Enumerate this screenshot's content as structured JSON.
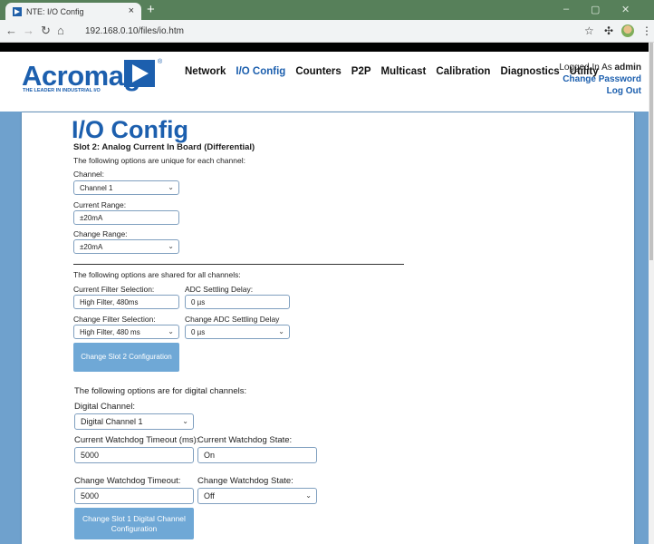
{
  "browser": {
    "tab_title": "NTE: I/O Config",
    "tab_close": "×",
    "new_tab": "+",
    "url": "192.168.0.10/files/io.htm",
    "minimize": "–",
    "maximize": "▢",
    "close": "✕"
  },
  "header": {
    "logo_text": "Acromag",
    "logo_tagline": "THE LEADER IN INDUSTRIAL I/O",
    "logo_registered": "®",
    "nav": [
      {
        "label": "Network"
      },
      {
        "label": "I/O Config"
      },
      {
        "label": "Counters"
      },
      {
        "label": "P2P"
      },
      {
        "label": "Multicast"
      },
      {
        "label": "Calibration"
      },
      {
        "label": "Diagnostics"
      },
      {
        "label": "Utility"
      }
    ],
    "logged_in_prefix": "Logged In As",
    "user": "admin",
    "change_password": "Change Password",
    "logout": "Log Out"
  },
  "page": {
    "title": "I/O Config",
    "slot_heading": "Slot 2: Analog Current In Board (Differential)",
    "unique_note": "The following options are unique for each channel:",
    "channel_label": "Channel:",
    "channel_value": "Channel 1",
    "current_range_label": "Current Range:",
    "current_range_value": "±20mA",
    "change_range_label": "Change Range:",
    "change_range_value": "±20mA",
    "shared_note": "The following options are shared for all channels:",
    "current_filter_label": "Current Filter Selection:",
    "current_filter_value": "High Filter, 480ms",
    "adc_delay_label": "ADC Settling Delay:",
    "adc_delay_value": "0 µs",
    "change_filter_label": "Change Filter Selection:",
    "change_filter_value": "High Filter, 480 ms",
    "change_adc_label": "Change ADC Settling Delay",
    "change_adc_value": "0 µs",
    "change_slot2_button": "Change Slot 2 Configuration",
    "digital_note": "The following options are for digital channels:",
    "digital_channel_label": "Digital Channel:",
    "digital_channel_value": "Digital Channel 1",
    "current_wd_timeout_label": "Current Watchdog Timeout (ms):",
    "current_wd_timeout_value": "5000",
    "current_wd_state_label": "Current Watchdog State:",
    "current_wd_state_value": "On",
    "change_wd_timeout_label": "Change Watchdog Timeout:",
    "change_wd_timeout_value": "5000",
    "change_wd_state_label": "Change Watchdog State:",
    "change_wd_state_value": "Off",
    "change_slot1_button": "Change Slot 1 Digital Channel Configuration"
  },
  "colors": {
    "brand_blue": "#1c5fae",
    "page_background": "#6fa1cd",
    "button_blue": "#6fa8d6",
    "tabbar_green": "#57805a"
  }
}
